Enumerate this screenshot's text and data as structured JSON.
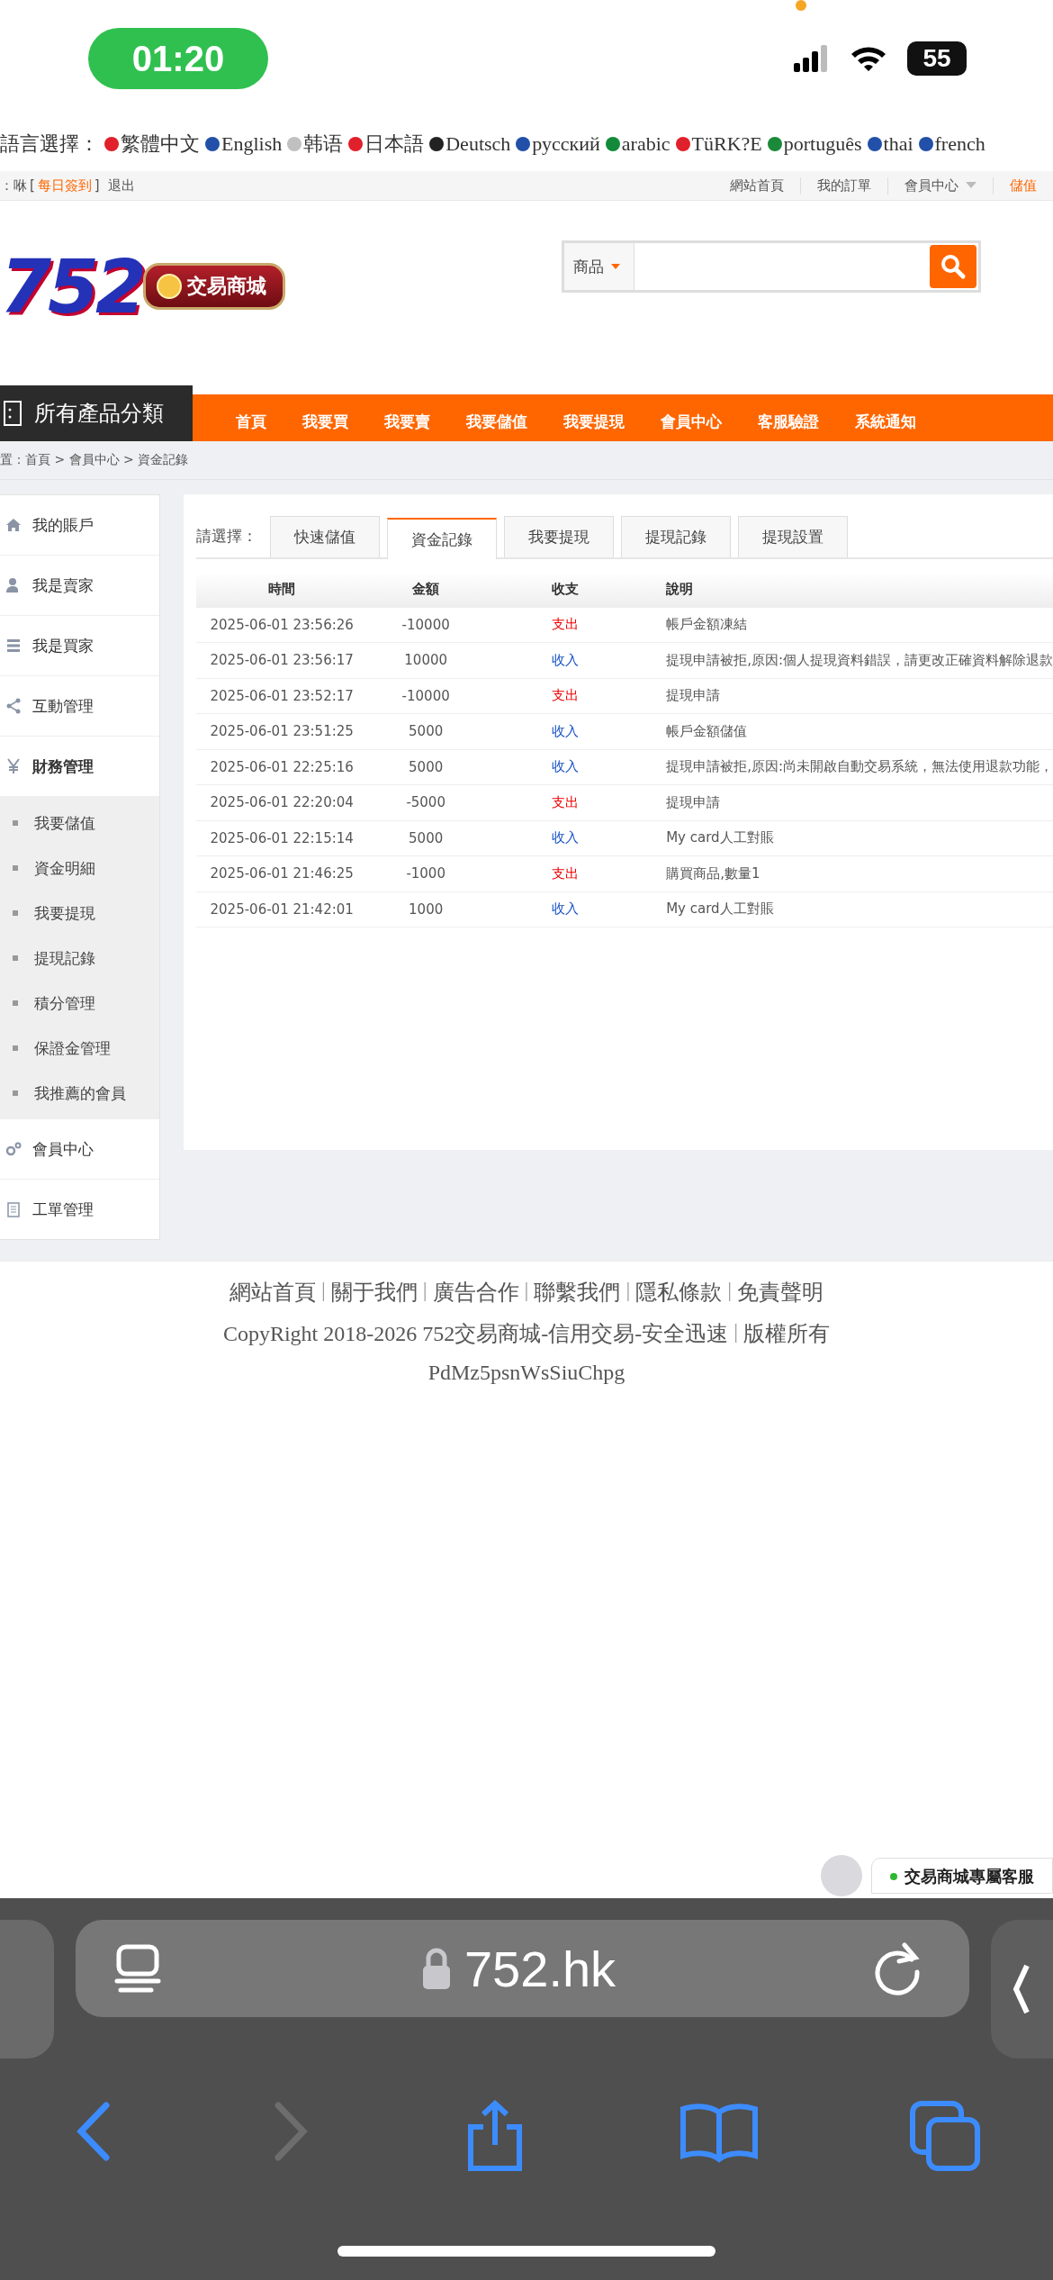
{
  "status_bar": {
    "time": "01:20",
    "battery": "55"
  },
  "language_bar": {
    "label": "語言選擇：",
    "languages": [
      "繁體中文",
      "English",
      "韩语",
      "日本語",
      "Deutsch",
      "русский",
      "arabic",
      "TüRK?E",
      "português",
      "thai",
      "french"
    ]
  },
  "top_bar": {
    "user": "：咻",
    "bracket_open": "[",
    "checkin": "每日簽到",
    "bracket_close": "]",
    "logout": "退出",
    "links": [
      {
        "label": "網站首頁",
        "kind": "plain"
      },
      {
        "label": "我的訂單",
        "kind": "plain"
      },
      {
        "label": "會員中心",
        "kind": "menu"
      },
      {
        "label": "儲值",
        "kind": "accent"
      }
    ]
  },
  "header": {
    "logo": "752",
    "logo_badge": "交易商城",
    "search": {
      "category": "商品"
    }
  },
  "nav": {
    "category_title": "所有產品分類",
    "items": [
      "首頁",
      "我要買",
      "我要賣",
      "我要儲值",
      "我要提現",
      "會員中心",
      "客服驗證",
      "系統通知"
    ]
  },
  "breadcrumb": "置：首頁 > 會員中心 > 資金記錄",
  "sidebar": {
    "items": [
      {
        "label": "我的賬戶",
        "expanded": false
      },
      {
        "label": "我是賣家",
        "expanded": false
      },
      {
        "label": "我是買家",
        "expanded": false
      },
      {
        "label": "互動管理",
        "expanded": false
      },
      {
        "label": "財務管理",
        "expanded": true,
        "children": [
          {
            "label": "我要儲值"
          },
          {
            "label": "資金明細"
          },
          {
            "label": "我要提現"
          },
          {
            "label": "提現記錄"
          },
          {
            "label": "積分管理"
          },
          {
            "label": "保證金管理"
          },
          {
            "label": "我推薦的會員"
          }
        ]
      },
      {
        "label": "會員中心",
        "expanded": false
      },
      {
        "label": "工單管理",
        "expanded": false
      }
    ]
  },
  "content": {
    "tabs_label": "請選擇：",
    "tabs": [
      {
        "label": "快速儲值",
        "selected": false
      },
      {
        "label": "資金記錄",
        "selected": true
      },
      {
        "label": "我要提現",
        "selected": false
      },
      {
        "label": "提現記錄",
        "selected": false
      },
      {
        "label": "提現設置",
        "selected": false
      }
    ],
    "table": {
      "columns": [
        "時間",
        "金額",
        "收支",
        "說明"
      ],
      "rows": [
        {
          "time": "2025-06-01 23:56:26",
          "amount": "-10000",
          "type": "支出",
          "kind": "expense",
          "note": "帳戶金額凍結"
        },
        {
          "time": "2025-06-01 23:56:17",
          "amount": "10000",
          "type": "收入",
          "kind": "income",
          "note": "提現申請被拒,原因:個人提現資料錯誤，請更改正確資料解除退款"
        },
        {
          "time": "2025-06-01 23:52:17",
          "amount": "-10000",
          "type": "支出",
          "kind": "expense",
          "note": "提現申請"
        },
        {
          "time": "2025-06-01 23:51:25",
          "amount": "5000",
          "type": "收入",
          "kind": "income",
          "note": "帳戶金額儲值"
        },
        {
          "time": "2025-06-01 22:25:16",
          "amount": "5000",
          "type": "收入",
          "kind": "income",
          "note": "提現申請被拒,原因:尚未開啟自動交易系統，無法使用退款功能，"
        },
        {
          "time": "2025-06-01 22:20:04",
          "amount": "-5000",
          "type": "支出",
          "kind": "expense",
          "note": "提現申請"
        },
        {
          "time": "2025-06-01 22:15:14",
          "amount": "5000",
          "type": "收入",
          "kind": "income",
          "note": "My card人工對賬"
        },
        {
          "time": "2025-06-01 21:46:25",
          "amount": "-1000",
          "type": "支出",
          "kind": "expense",
          "note": "購買商品,數量1"
        },
        {
          "time": "2025-06-01 21:42:01",
          "amount": "1000",
          "type": "收入",
          "kind": "income",
          "note": "My card人工對賬"
        }
      ]
    }
  },
  "footer": {
    "separator": "|",
    "links": [
      "網站首頁",
      "關于我們",
      "廣告合作",
      "聯繫我們",
      "隱私條款",
      "免責聲明"
    ],
    "copyright": [
      "CopyRight 2018-2026 752交易商城-信用交易-安全迅速",
      "版權所有"
    ],
    "code": "PdMz5psnWsSiuChpg"
  },
  "chat_widget": {
    "label": "交易商城專屬客服"
  },
  "browser": {
    "url": "752.hk"
  }
}
